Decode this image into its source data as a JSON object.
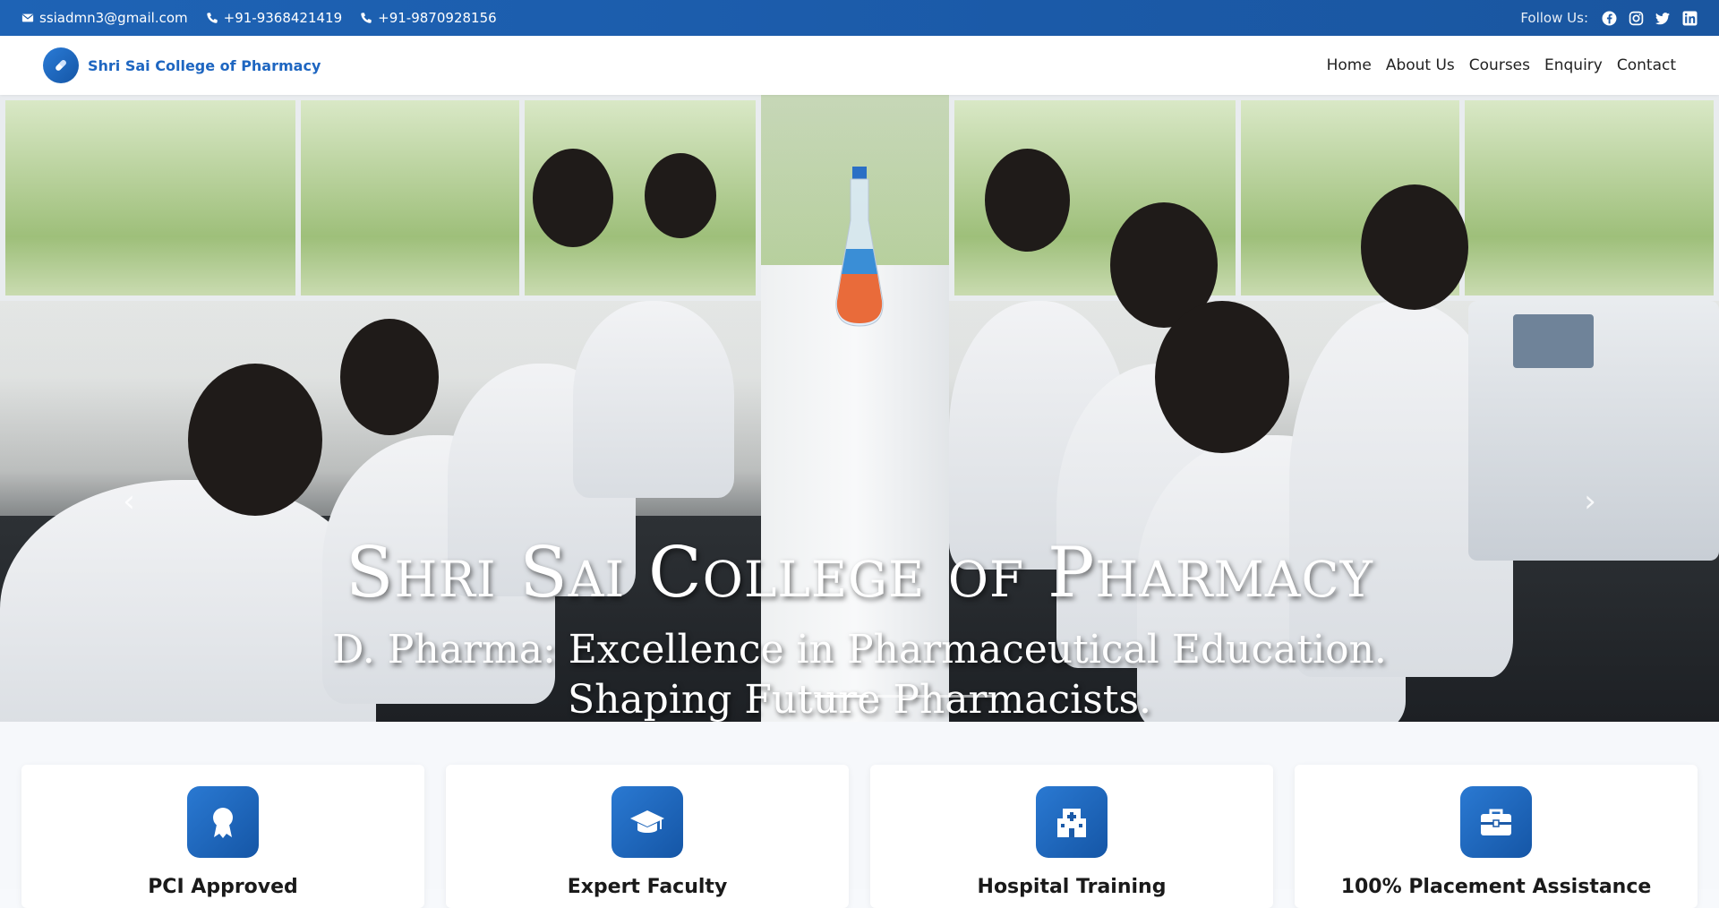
{
  "topbar": {
    "email": "ssiadmn3@gmail.com",
    "phone1": "+91-9368421419",
    "phone2": "+91-9870928156",
    "follow_label": "Follow Us:"
  },
  "header": {
    "brand": "Shri Sai College of Pharmacy",
    "nav": [
      "Home",
      "About Us",
      "Courses",
      "Enquiry",
      "Contact"
    ]
  },
  "hero": {
    "title": "Shri Sai College of Pharmacy",
    "subtitle_line1": "D. Pharma: Excellence in Pharmaceutical Education.",
    "subtitle_line2": "Shaping Future Pharmacists.",
    "slide_count": 3,
    "active_slide": 1
  },
  "features": [
    {
      "title": "PCI Approved",
      "icon": "award-icon"
    },
    {
      "title": "Expert Faculty",
      "icon": "graduation-cap-icon"
    },
    {
      "title": "Hospital Training",
      "icon": "hospital-icon"
    },
    {
      "title": "100% Placement Assistance",
      "icon": "briefcase-icon"
    }
  ],
  "colors": {
    "primary": "#1e66c1",
    "topbar": "#1b5aa8",
    "accent_gradient_start": "#2a79d2",
    "accent_gradient_end": "#1556a6"
  }
}
